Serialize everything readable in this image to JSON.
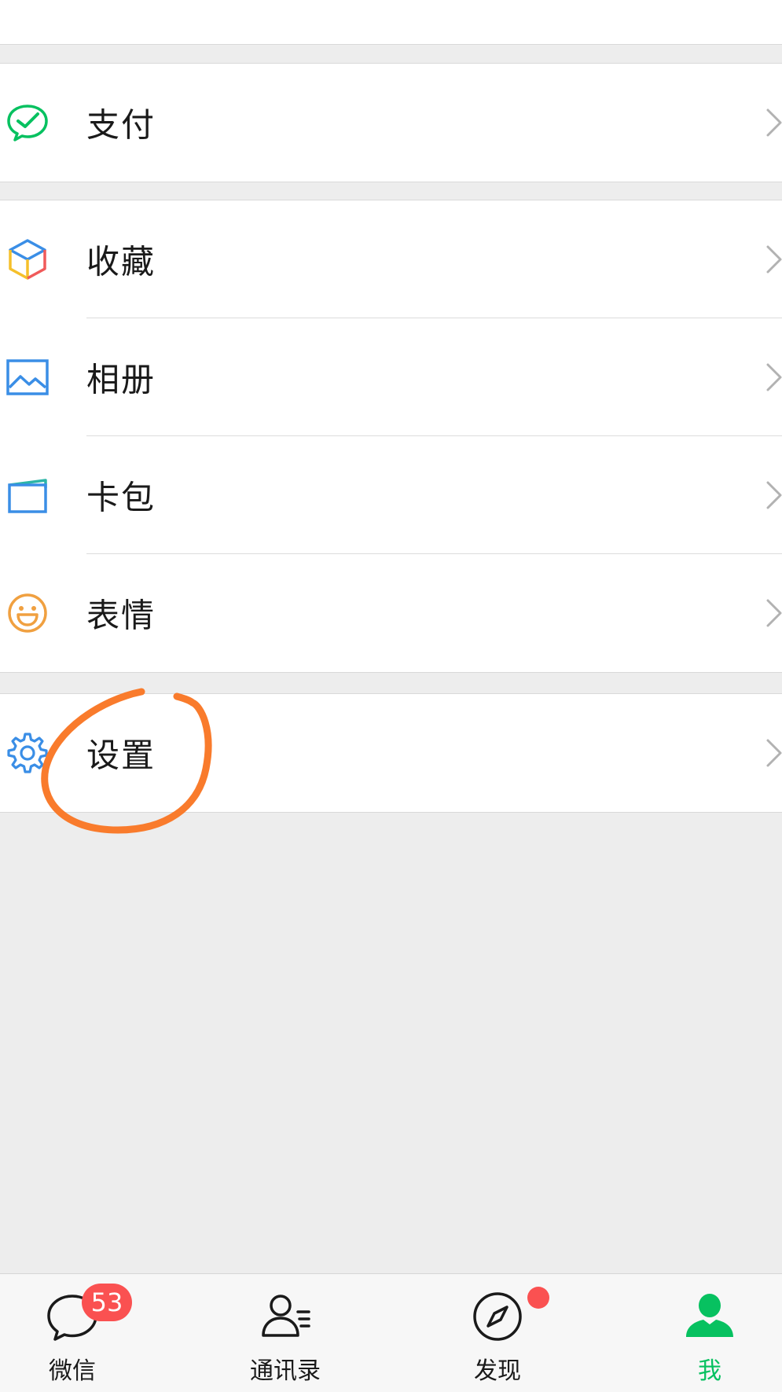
{
  "menu": {
    "pay": {
      "label": "支付",
      "icon": "wechat-pay-icon"
    },
    "favorites": {
      "label": "收藏",
      "icon": "favorites-cube-icon"
    },
    "album": {
      "label": "相册",
      "icon": "album-photo-icon"
    },
    "cards": {
      "label": "卡包",
      "icon": "card-wallet-icon"
    },
    "stickers": {
      "label": "表情",
      "icon": "smiley-icon"
    },
    "settings": {
      "label": "设置",
      "icon": "gear-icon"
    }
  },
  "annotation": {
    "shape": "circle",
    "color": "#f97b2c",
    "target": "settings"
  },
  "tabbar": {
    "chats": {
      "label": "微信",
      "badge": "53",
      "icon": "chat-bubble-icon"
    },
    "contacts": {
      "label": "通讯录",
      "icon": "contacts-icon"
    },
    "discover": {
      "label": "发现",
      "icon": "compass-icon",
      "has_dot": true
    },
    "me": {
      "label": "我",
      "icon": "person-icon",
      "active": true
    }
  },
  "colors": {
    "accent_green": "#07c160",
    "badge_red": "#fa5151",
    "background": "#ededed"
  }
}
